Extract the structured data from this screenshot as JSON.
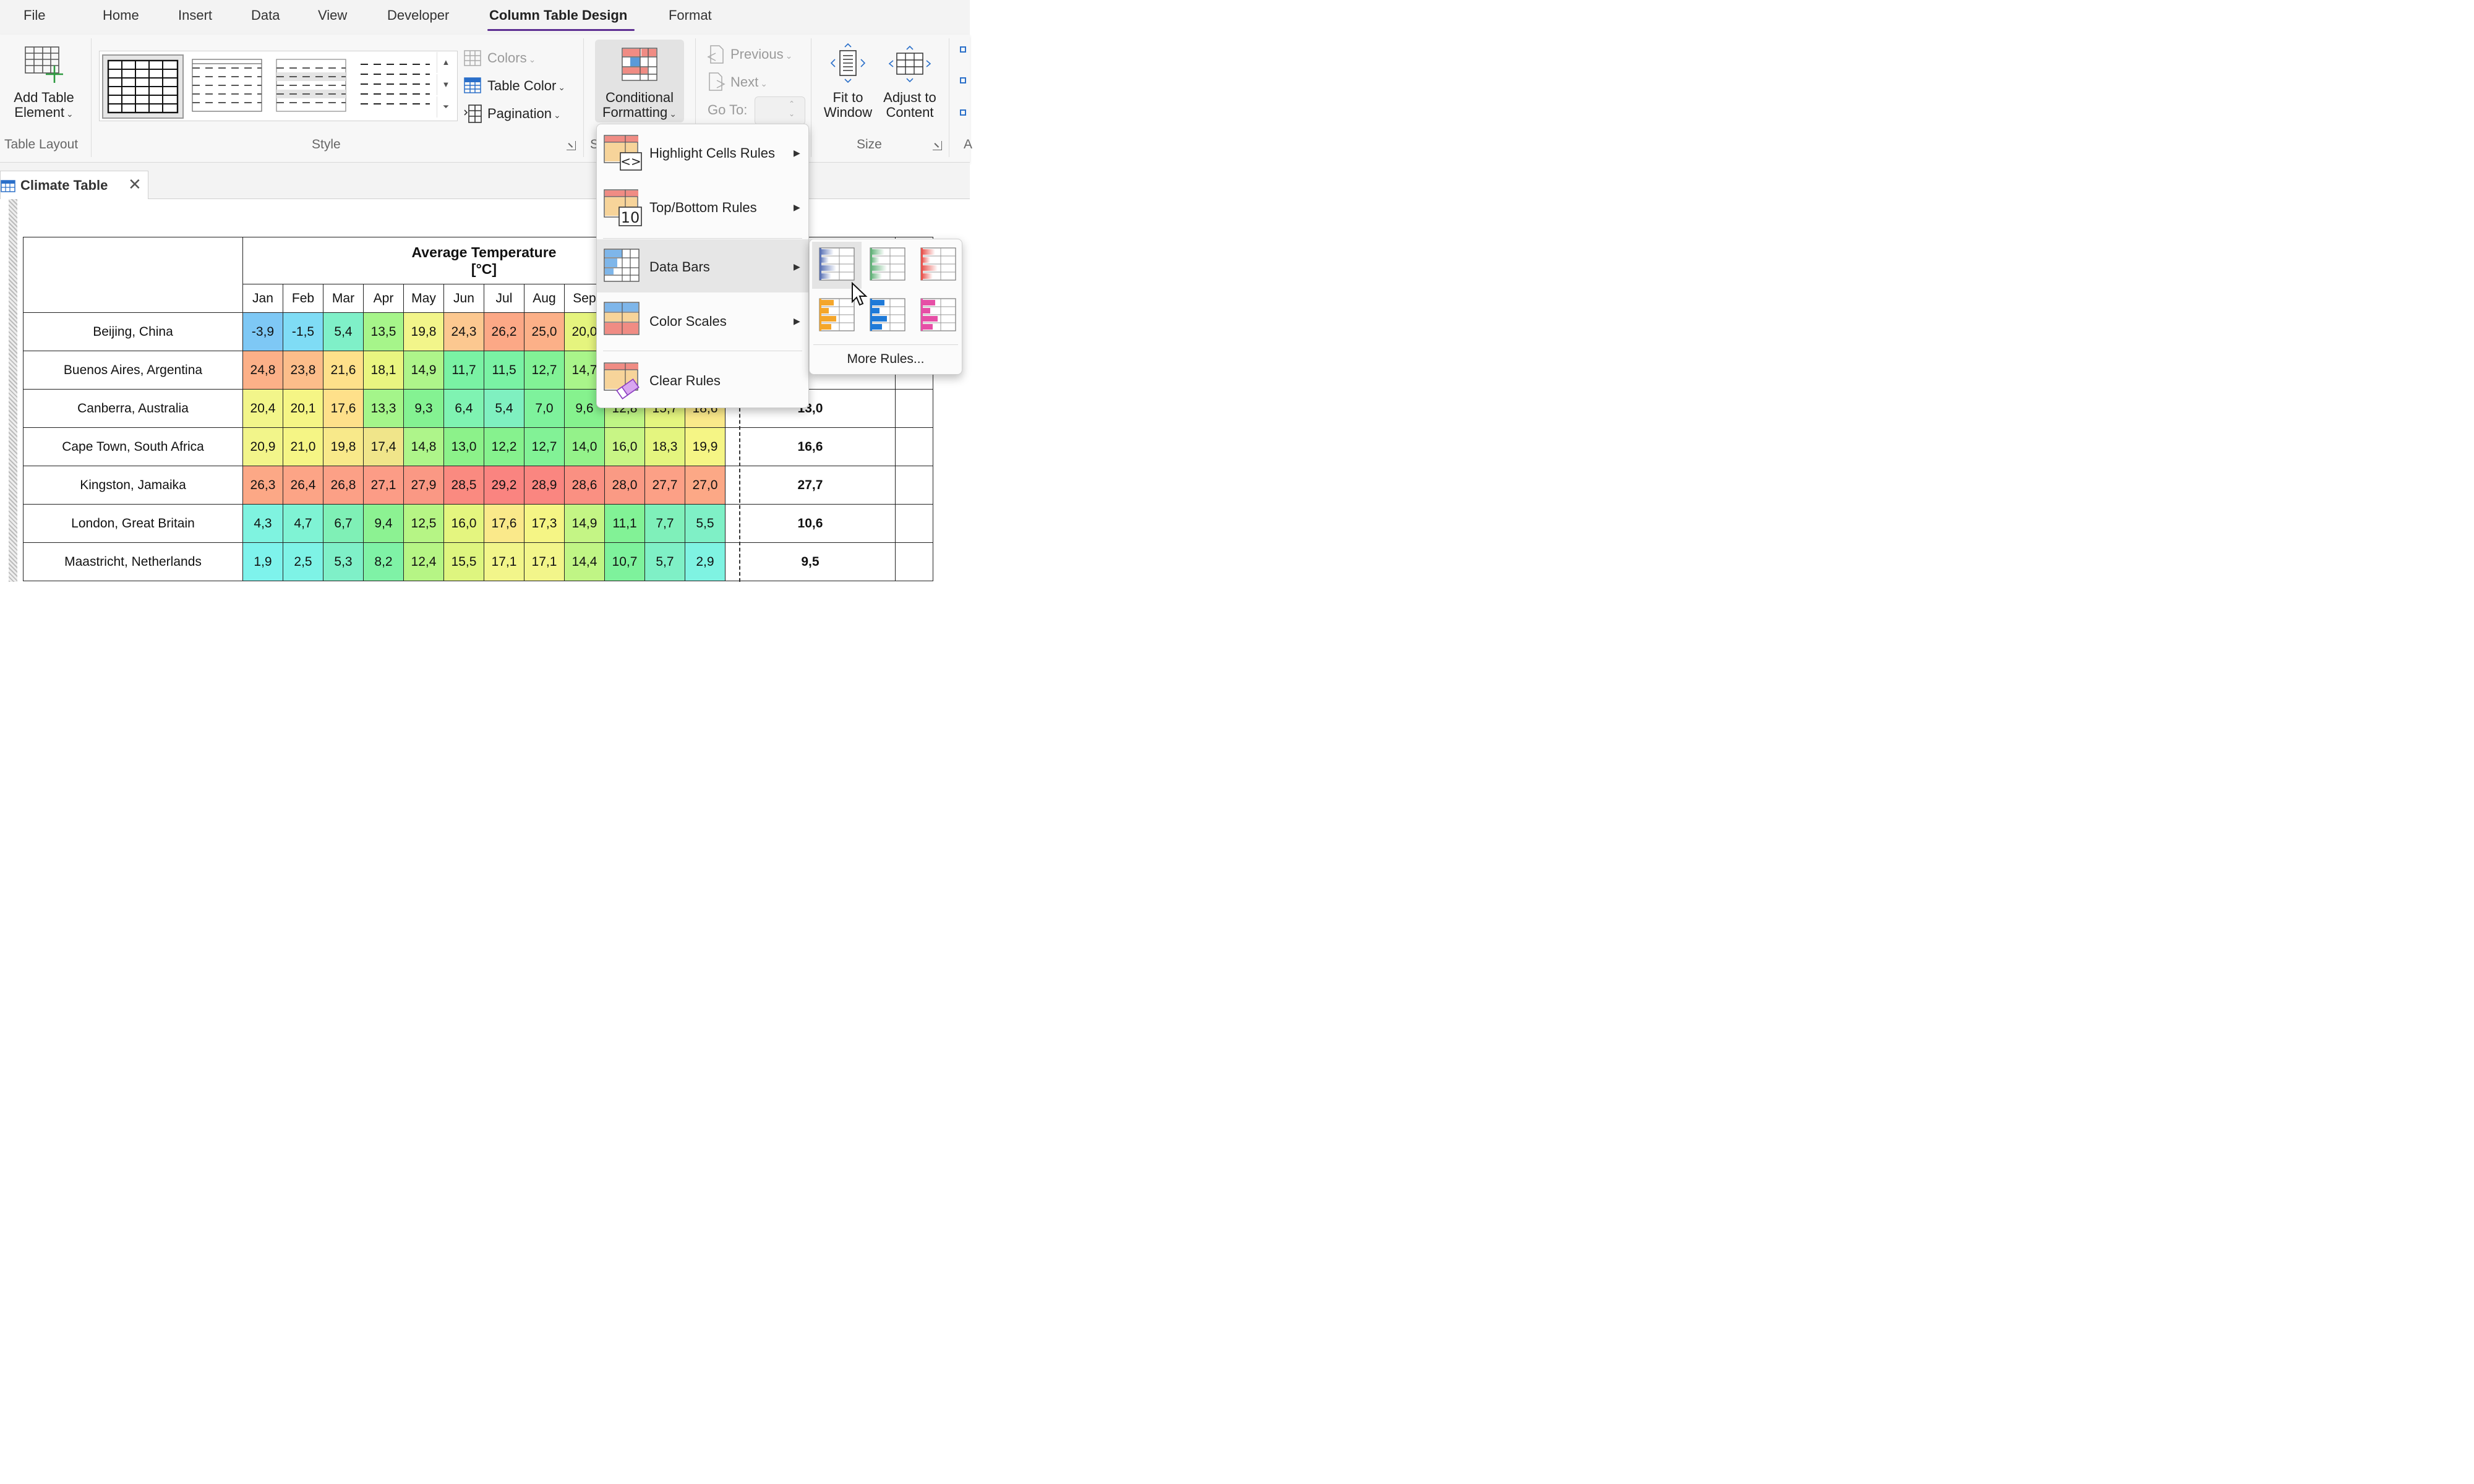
{
  "menu": {
    "tabs": [
      {
        "label": "File"
      },
      {
        "label": "Home"
      },
      {
        "label": "Insert"
      },
      {
        "label": "Data"
      },
      {
        "label": "View"
      },
      {
        "label": "Developer"
      },
      {
        "label": "Column Table Design",
        "active": true
      },
      {
        "label": "Format"
      }
    ]
  },
  "ribbon": {
    "table_layout": {
      "add_table_element_line1": "Add Table",
      "add_table_element_line2": "Element",
      "group_label": "Table Layout"
    },
    "style": {
      "group_label": "Style",
      "colors_label": "Colors",
      "table_color_label": "Table Color",
      "pagination_label": "Pagination"
    },
    "conditional_formatting": {
      "line1": "Conditional",
      "line2": "Formatting",
      "group_label_partial": "S"
    },
    "navigation": {
      "previous_label": "Previous",
      "next_label": "Next",
      "goto_label": "Go To:"
    },
    "size": {
      "fit_line1": "Fit to",
      "fit_line2": "Window",
      "adjust_line1": "Adjust to",
      "adjust_line2": "Content",
      "group_label": "Size",
      "next_group_partial": "A"
    }
  },
  "document_tab": {
    "title": "Climate Table"
  },
  "table": {
    "header_title_line1": "Average Temperature",
    "header_title_line2": "[°C]",
    "months": [
      "Jan",
      "Feb",
      "Mar",
      "Apr",
      "May",
      "Jun",
      "Jul",
      "Aug",
      "Sep"
    ],
    "rows": [
      {
        "city": "Beijing, China",
        "values": [
          "-3,9",
          "-1,5",
          "5,4",
          "13,5",
          "19,8",
          "24,3",
          "26,2",
          "25,0",
          "20,0"
        ],
        "mean": ""
      },
      {
        "city": "Buenos Aires, Argentina",
        "values": [
          "24,8",
          "23,8",
          "21,6",
          "18,1",
          "14,9",
          "11,7",
          "11,5",
          "12,7",
          "14,7"
        ],
        "mean": ""
      },
      {
        "city": "Canberra, Australia",
        "values": [
          "20,4",
          "20,1",
          "17,6",
          "13,3",
          "9,3",
          "6,4",
          "5,4",
          "7,0",
          "9,6",
          "12,8",
          "15,7",
          "18,6"
        ],
        "mean": "13,0"
      },
      {
        "city": "Cape Town, South Africa",
        "values": [
          "20,9",
          "21,0",
          "19,8",
          "17,4",
          "14,8",
          "13,0",
          "12,2",
          "12,7",
          "14,0",
          "16,0",
          "18,3",
          "19,9"
        ],
        "mean": "16,6"
      },
      {
        "city": "Kingston, Jamaika",
        "values": [
          "26,3",
          "26,4",
          "26,8",
          "27,1",
          "27,9",
          "28,5",
          "29,2",
          "28,9",
          "28,6",
          "28,0",
          "27,7",
          "27,0"
        ],
        "mean": "27,7"
      },
      {
        "city": "London, Great Britain",
        "values": [
          "4,3",
          "4,7",
          "6,7",
          "9,4",
          "12,5",
          "16,0",
          "17,6",
          "17,3",
          "14,9",
          "11,1",
          "7,7",
          "5,5"
        ],
        "mean": "10,6"
      },
      {
        "city": "Maastricht, Netherlands",
        "values": [
          "1,9",
          "2,5",
          "5,3",
          "8,2",
          "12,4",
          "15,5",
          "17,1",
          "17,1",
          "14,4",
          "10,7",
          "5,7",
          "2,9"
        ],
        "mean": "9,5"
      }
    ],
    "cell_colors": [
      [
        "#7ec8f5",
        "#7fdcf5",
        "#7ff0c8",
        "#a6f58a",
        "#f2f58a",
        "#fcc890",
        "#fca886",
        "#fcb088",
        "#e5f47e"
      ],
      [
        "#fcb088",
        "#fcbd8a",
        "#fee08a",
        "#e9f580",
        "#aef58a",
        "#7af2a4",
        "#7af2a4",
        "#82f296",
        "#a9f58a"
      ],
      [
        "#f2f58a",
        "#f5f585",
        "#fee08a",
        "#a4f58a",
        "#84f292",
        "#7ff3b2",
        "#7ff0c0",
        "#7ef29c",
        "#86f28e",
        "#bff585",
        "#e4f57f",
        "#fae98a"
      ],
      [
        "#f2f58a",
        "#f5f585",
        "#f8e98a",
        "#f0e58a",
        "#aef58a",
        "#8cf28a",
        "#86f28e",
        "#82f296",
        "#94f28a",
        "#c8f585",
        "#e4f57f",
        "#f5f585"
      ],
      [
        "#fca886",
        "#fca486",
        "#fca086",
        "#fc9c86",
        "#fa9884",
        "#fa8a80",
        "#fa8480",
        "#fa8680",
        "#fa9082",
        "#fa9a84",
        "#fca086",
        "#fca886"
      ],
      [
        "#7ff3e0",
        "#7ff3d4",
        "#7ff0b6",
        "#8cf292",
        "#b6f585",
        "#e4f57f",
        "#fae98a",
        "#f5f585",
        "#c4f585",
        "#82f296",
        "#7ff0ba",
        "#7ff0c6"
      ],
      [
        "#7ef3ec",
        "#7ef3e6",
        "#7ff0c8",
        "#7ff2a6",
        "#b6f585",
        "#def57f",
        "#f2f58a",
        "#f2f58a",
        "#c0f585",
        "#7ef29c",
        "#7ff0c6",
        "#7ff3e2"
      ]
    ]
  },
  "conditional_menu": {
    "items": [
      {
        "label": "Highlight Cells Rules"
      },
      {
        "label": "Top/Bottom Rules"
      },
      {
        "label": "Data Bars"
      },
      {
        "label": "Color Scales"
      },
      {
        "label": "Clear Rules"
      }
    ],
    "top_bottom_icon_text": "10"
  },
  "data_bars_menu": {
    "swatches": [
      {
        "name": "blue-gradient",
        "color": "#5b73b5"
      },
      {
        "name": "green-gradient",
        "color": "#63b27a"
      },
      {
        "name": "red-gradient",
        "color": "#e8544e"
      },
      {
        "name": "orange-solid",
        "color": "#f4a62a"
      },
      {
        "name": "blue-solid",
        "color": "#1f7ad8"
      },
      {
        "name": "pink-solid",
        "color": "#e64fa6"
      }
    ],
    "more_rules_label": "More Rules..."
  }
}
